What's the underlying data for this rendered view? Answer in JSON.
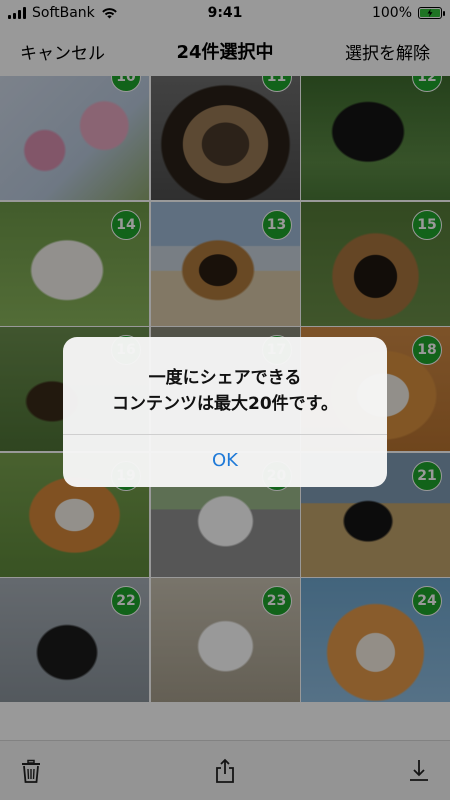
{
  "status_bar": {
    "carrier": "SoftBank",
    "time": "9:41",
    "battery": "100%",
    "battery_level": 1.0,
    "icons": [
      "signal-bars-icon",
      "wifi-icon",
      "battery-charging-icon"
    ]
  },
  "nav": {
    "cancel_label": "キャンセル",
    "title": "24件選択中",
    "deselect_label": "選択を解除"
  },
  "grid": {
    "tiles": [
      {
        "badge": "10"
      },
      {
        "badge": "11"
      },
      {
        "badge": "12"
      },
      {
        "badge": "14"
      },
      {
        "badge": "13"
      },
      {
        "badge": "15"
      },
      {
        "badge": "16"
      },
      {
        "badge": "17"
      },
      {
        "badge": "18"
      },
      {
        "badge": "19"
      },
      {
        "badge": "20"
      },
      {
        "badge": "21"
      },
      {
        "badge": "22"
      },
      {
        "badge": "23"
      },
      {
        "badge": "24"
      }
    ],
    "badge_color": "#1fa52c"
  },
  "alert": {
    "line1": "一度にシェアできる",
    "line2": "コンテンツは最大20件です。",
    "ok_label": "OK",
    "ok_color": "#1f7ad8"
  },
  "toolbar": {
    "icons": [
      "trash-icon",
      "share-icon",
      "download-icon"
    ]
  }
}
